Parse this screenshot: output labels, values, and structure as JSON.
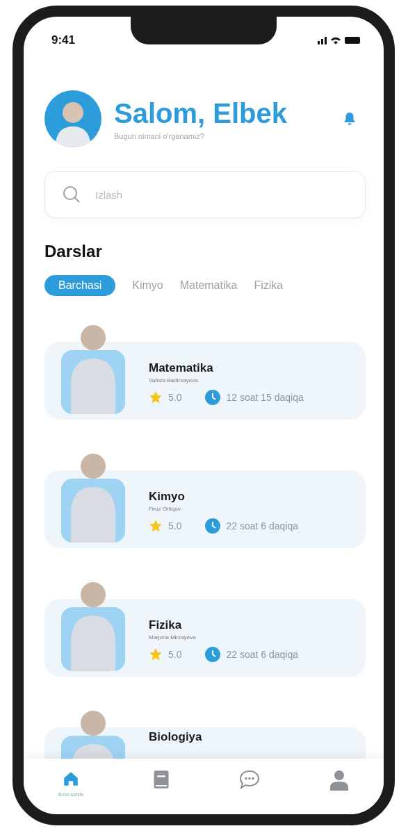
{
  "status_bar": {
    "time": "9:41"
  },
  "header": {
    "greeting": "Salom, Elbek",
    "subtitle": "Bugun nimani o'rganamiz?"
  },
  "search": {
    "placeholder": "Izlash"
  },
  "section_title": "Darslar",
  "tabs": [
    {
      "label": "Barchasi",
      "selected": true
    },
    {
      "label": "Kimyo",
      "selected": false
    },
    {
      "label": "Matematika",
      "selected": false
    },
    {
      "label": "Fizika",
      "selected": false
    }
  ],
  "courses": [
    {
      "title": "Matematika",
      "teacher": "Vafoza Badirxayeva",
      "rating": "5.0",
      "duration": "12 soat 15 daqiqa"
    },
    {
      "title": "Kimyo",
      "teacher": "Firuz Ortiqov",
      "rating": "5.0",
      "duration": "22 soat 6 daqiqa"
    },
    {
      "title": "Fizika",
      "teacher": "Marjona Mirzayeva",
      "rating": "5.0",
      "duration": "22 soat 6 daqiqa"
    },
    {
      "title": "Biologiya"
    }
  ],
  "bottom_nav": [
    {
      "kind": "home",
      "label": "Bosh sahifa",
      "selected": true
    },
    {
      "kind": "book",
      "selected": false
    },
    {
      "kind": "chat",
      "selected": false
    },
    {
      "kind": "user",
      "selected": false
    }
  ]
}
